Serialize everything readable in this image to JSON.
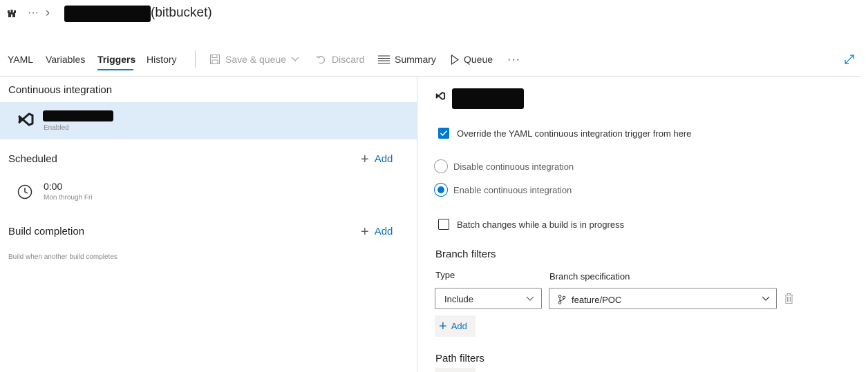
{
  "header": {
    "breadcrumb_more": "···",
    "breadcrumb_sep": "›",
    "pipeline_suffix": "(bitbucket)"
  },
  "tabs": [
    {
      "label": "YAML"
    },
    {
      "label": "Variables"
    },
    {
      "label": "Triggers",
      "active": true
    },
    {
      "label": "History"
    }
  ],
  "toolbar": {
    "save_queue": "Save & queue",
    "discard": "Discard",
    "summary": "Summary",
    "queue": "Queue",
    "more": "···"
  },
  "left": {
    "ci_title": "Continuous integration",
    "ci_item_status": "Enabled",
    "scheduled_title": "Scheduled",
    "scheduled_add": "Add",
    "schedule_time": "0:00",
    "schedule_days": "Mon through Fri",
    "build_completion_title": "Build completion",
    "build_completion_add": "Add",
    "build_completion_desc": "Build when another build completes"
  },
  "right": {
    "override_label": "Override the YAML continuous integration trigger from here",
    "override_checked": true,
    "disable_ci": "Disable continuous integration",
    "enable_ci": "Enable continuous integration",
    "batch_label": "Batch changes while a build is in progress",
    "batch_checked": false,
    "branch_filters_title": "Branch filters",
    "type_label": "Type",
    "branch_spec_label": "Branch specification",
    "type_value": "Include",
    "branch_value": "feature/POC",
    "add_label": "Add",
    "path_filters_title": "Path filters"
  },
  "colors": {
    "accent": "#0078d4",
    "selected_row": "#deecf9",
    "link": "#106ebe"
  },
  "icons": [
    "castle-icon",
    "chevron-right-icon",
    "save-icon",
    "undo-icon",
    "list-icon",
    "play-icon",
    "expand-icon",
    "visual-studio-icon",
    "clock-icon",
    "branch-icon",
    "trash-icon",
    "chevron-down-icon",
    "plus-icon"
  ]
}
